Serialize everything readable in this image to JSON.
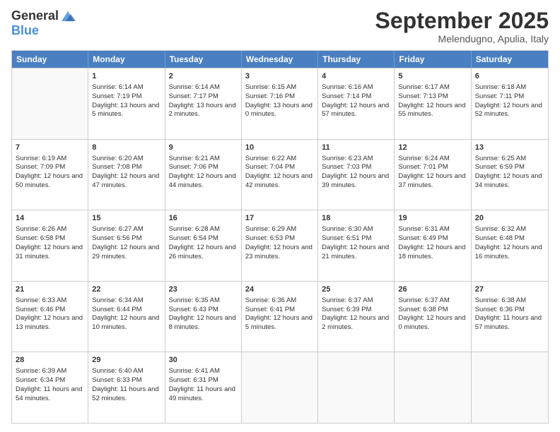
{
  "logo": {
    "general": "General",
    "blue": "Blue"
  },
  "header": {
    "month": "September 2025",
    "location": "Melendugno, Apulia, Italy"
  },
  "weekdays": [
    "Sunday",
    "Monday",
    "Tuesday",
    "Wednesday",
    "Thursday",
    "Friday",
    "Saturday"
  ],
  "weeks": [
    [
      {
        "day": "",
        "sunrise": "",
        "sunset": "",
        "daylight": ""
      },
      {
        "day": "1",
        "sunrise": "Sunrise: 6:14 AM",
        "sunset": "Sunset: 7:19 PM",
        "daylight": "Daylight: 13 hours and 5 minutes."
      },
      {
        "day": "2",
        "sunrise": "Sunrise: 6:14 AM",
        "sunset": "Sunset: 7:17 PM",
        "daylight": "Daylight: 13 hours and 2 minutes."
      },
      {
        "day": "3",
        "sunrise": "Sunrise: 6:15 AM",
        "sunset": "Sunset: 7:16 PM",
        "daylight": "Daylight: 13 hours and 0 minutes."
      },
      {
        "day": "4",
        "sunrise": "Sunrise: 6:16 AM",
        "sunset": "Sunset: 7:14 PM",
        "daylight": "Daylight: 12 hours and 57 minutes."
      },
      {
        "day": "5",
        "sunrise": "Sunrise: 6:17 AM",
        "sunset": "Sunset: 7:13 PM",
        "daylight": "Daylight: 12 hours and 55 minutes."
      },
      {
        "day": "6",
        "sunrise": "Sunrise: 6:18 AM",
        "sunset": "Sunset: 7:11 PM",
        "daylight": "Daylight: 12 hours and 52 minutes."
      }
    ],
    [
      {
        "day": "7",
        "sunrise": "Sunrise: 6:19 AM",
        "sunset": "Sunset: 7:09 PM",
        "daylight": "Daylight: 12 hours and 50 minutes."
      },
      {
        "day": "8",
        "sunrise": "Sunrise: 6:20 AM",
        "sunset": "Sunset: 7:08 PM",
        "daylight": "Daylight: 12 hours and 47 minutes."
      },
      {
        "day": "9",
        "sunrise": "Sunrise: 6:21 AM",
        "sunset": "Sunset: 7:06 PM",
        "daylight": "Daylight: 12 hours and 44 minutes."
      },
      {
        "day": "10",
        "sunrise": "Sunrise: 6:22 AM",
        "sunset": "Sunset: 7:04 PM",
        "daylight": "Daylight: 12 hours and 42 minutes."
      },
      {
        "day": "11",
        "sunrise": "Sunrise: 6:23 AM",
        "sunset": "Sunset: 7:03 PM",
        "daylight": "Daylight: 12 hours and 39 minutes."
      },
      {
        "day": "12",
        "sunrise": "Sunrise: 6:24 AM",
        "sunset": "Sunset: 7:01 PM",
        "daylight": "Daylight: 12 hours and 37 minutes."
      },
      {
        "day": "13",
        "sunrise": "Sunrise: 6:25 AM",
        "sunset": "Sunset: 6:59 PM",
        "daylight": "Daylight: 12 hours and 34 minutes."
      }
    ],
    [
      {
        "day": "14",
        "sunrise": "Sunrise: 6:26 AM",
        "sunset": "Sunset: 6:58 PM",
        "daylight": "Daylight: 12 hours and 31 minutes."
      },
      {
        "day": "15",
        "sunrise": "Sunrise: 6:27 AM",
        "sunset": "Sunset: 6:56 PM",
        "daylight": "Daylight: 12 hours and 29 minutes."
      },
      {
        "day": "16",
        "sunrise": "Sunrise: 6:28 AM",
        "sunset": "Sunset: 6:54 PM",
        "daylight": "Daylight: 12 hours and 26 minutes."
      },
      {
        "day": "17",
        "sunrise": "Sunrise: 6:29 AM",
        "sunset": "Sunset: 6:53 PM",
        "daylight": "Daylight: 12 hours and 23 minutes."
      },
      {
        "day": "18",
        "sunrise": "Sunrise: 6:30 AM",
        "sunset": "Sunset: 6:51 PM",
        "daylight": "Daylight: 12 hours and 21 minutes."
      },
      {
        "day": "19",
        "sunrise": "Sunrise: 6:31 AM",
        "sunset": "Sunset: 6:49 PM",
        "daylight": "Daylight: 12 hours and 18 minutes."
      },
      {
        "day": "20",
        "sunrise": "Sunrise: 6:32 AM",
        "sunset": "Sunset: 6:48 PM",
        "daylight": "Daylight: 12 hours and 16 minutes."
      }
    ],
    [
      {
        "day": "21",
        "sunrise": "Sunrise: 6:33 AM",
        "sunset": "Sunset: 6:46 PM",
        "daylight": "Daylight: 12 hours and 13 minutes."
      },
      {
        "day": "22",
        "sunrise": "Sunrise: 6:34 AM",
        "sunset": "Sunset: 6:44 PM",
        "daylight": "Daylight: 12 hours and 10 minutes."
      },
      {
        "day": "23",
        "sunrise": "Sunrise: 6:35 AM",
        "sunset": "Sunset: 6:43 PM",
        "daylight": "Daylight: 12 hours and 8 minutes."
      },
      {
        "day": "24",
        "sunrise": "Sunrise: 6:36 AM",
        "sunset": "Sunset: 6:41 PM",
        "daylight": "Daylight: 12 hours and 5 minutes."
      },
      {
        "day": "25",
        "sunrise": "Sunrise: 6:37 AM",
        "sunset": "Sunset: 6:39 PM",
        "daylight": "Daylight: 12 hours and 2 minutes."
      },
      {
        "day": "26",
        "sunrise": "Sunrise: 6:37 AM",
        "sunset": "Sunset: 6:38 PM",
        "daylight": "Daylight: 12 hours and 0 minutes."
      },
      {
        "day": "27",
        "sunrise": "Sunrise: 6:38 AM",
        "sunset": "Sunset: 6:36 PM",
        "daylight": "Daylight: 11 hours and 57 minutes."
      }
    ],
    [
      {
        "day": "28",
        "sunrise": "Sunrise: 6:39 AM",
        "sunset": "Sunset: 6:34 PM",
        "daylight": "Daylight: 11 hours and 54 minutes."
      },
      {
        "day": "29",
        "sunrise": "Sunrise: 6:40 AM",
        "sunset": "Sunset: 6:33 PM",
        "daylight": "Daylight: 11 hours and 52 minutes."
      },
      {
        "day": "30",
        "sunrise": "Sunrise: 6:41 AM",
        "sunset": "Sunset: 6:31 PM",
        "daylight": "Daylight: 11 hours and 49 minutes."
      },
      {
        "day": "",
        "sunrise": "",
        "sunset": "",
        "daylight": ""
      },
      {
        "day": "",
        "sunrise": "",
        "sunset": "",
        "daylight": ""
      },
      {
        "day": "",
        "sunrise": "",
        "sunset": "",
        "daylight": ""
      },
      {
        "day": "",
        "sunrise": "",
        "sunset": "",
        "daylight": ""
      }
    ]
  ]
}
